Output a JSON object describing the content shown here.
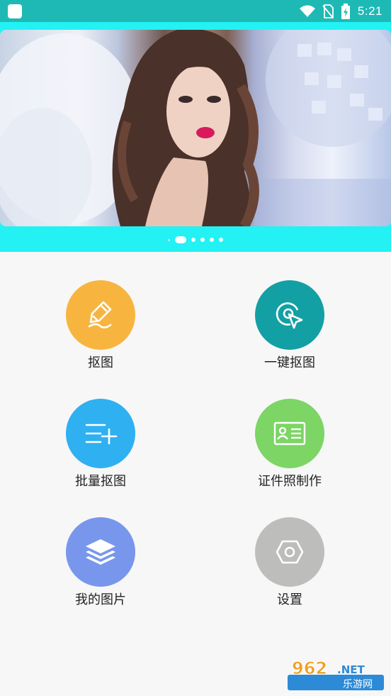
{
  "status_bar": {
    "time": "5:21",
    "icons": [
      "app-icon",
      "wifi-icon",
      "no-sim-icon",
      "battery-charging-icon"
    ]
  },
  "banner": {
    "slide_count": 5,
    "active_index": 0,
    "colors": {
      "frame": "#23f1f3",
      "status_bar": "#1fb9b5"
    }
  },
  "features": [
    {
      "label": "抠图",
      "icon": "pen-edit-icon",
      "color": "#f7b53f"
    },
    {
      "label": "一键抠图",
      "icon": "cursor-target-icon",
      "color": "#13a0a4"
    },
    {
      "label": "批量抠图",
      "icon": "list-add-icon",
      "color": "#2fb0f1"
    },
    {
      "label": "证件照制作",
      "icon": "id-card-icon",
      "color": "#7cd565"
    },
    {
      "label": "我的图片",
      "icon": "layers-icon",
      "color": "#7897ec"
    },
    {
      "label": "设置",
      "icon": "settings-hexagon-icon",
      "color": "#bdbdbb"
    }
  ],
  "watermark": {
    "text_top": "962",
    "text_net": "NET",
    "text_bottom": "乐游网"
  }
}
